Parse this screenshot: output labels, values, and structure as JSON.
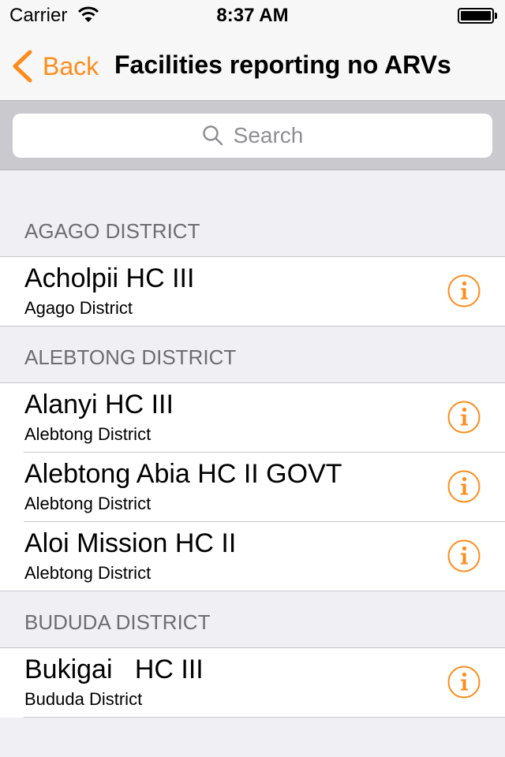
{
  "status_bar": {
    "carrier": "Carrier",
    "time": "8:37 AM"
  },
  "nav": {
    "back_label": "Back",
    "title": "Facilities reporting no ARVs"
  },
  "search": {
    "placeholder": "Search"
  },
  "accent_color": "#ff8c1a",
  "sections": [
    {
      "header": "AGAGO DISTRICT",
      "items": [
        {
          "name": "Acholpii HC III",
          "district": "Agago District"
        }
      ]
    },
    {
      "header": "ALEBTONG DISTRICT",
      "items": [
        {
          "name": "Alanyi HC III",
          "district": "Alebtong District"
        },
        {
          "name": "Alebtong Abia HC II GOVT",
          "district": "Alebtong District"
        },
        {
          "name": "Aloi Mission HC II",
          "district": "Alebtong District"
        }
      ]
    },
    {
      "header": "BUDUDA DISTRICT",
      "items": [
        {
          "name": "Bukigai   HC III",
          "district": "Bududa District"
        }
      ]
    }
  ]
}
